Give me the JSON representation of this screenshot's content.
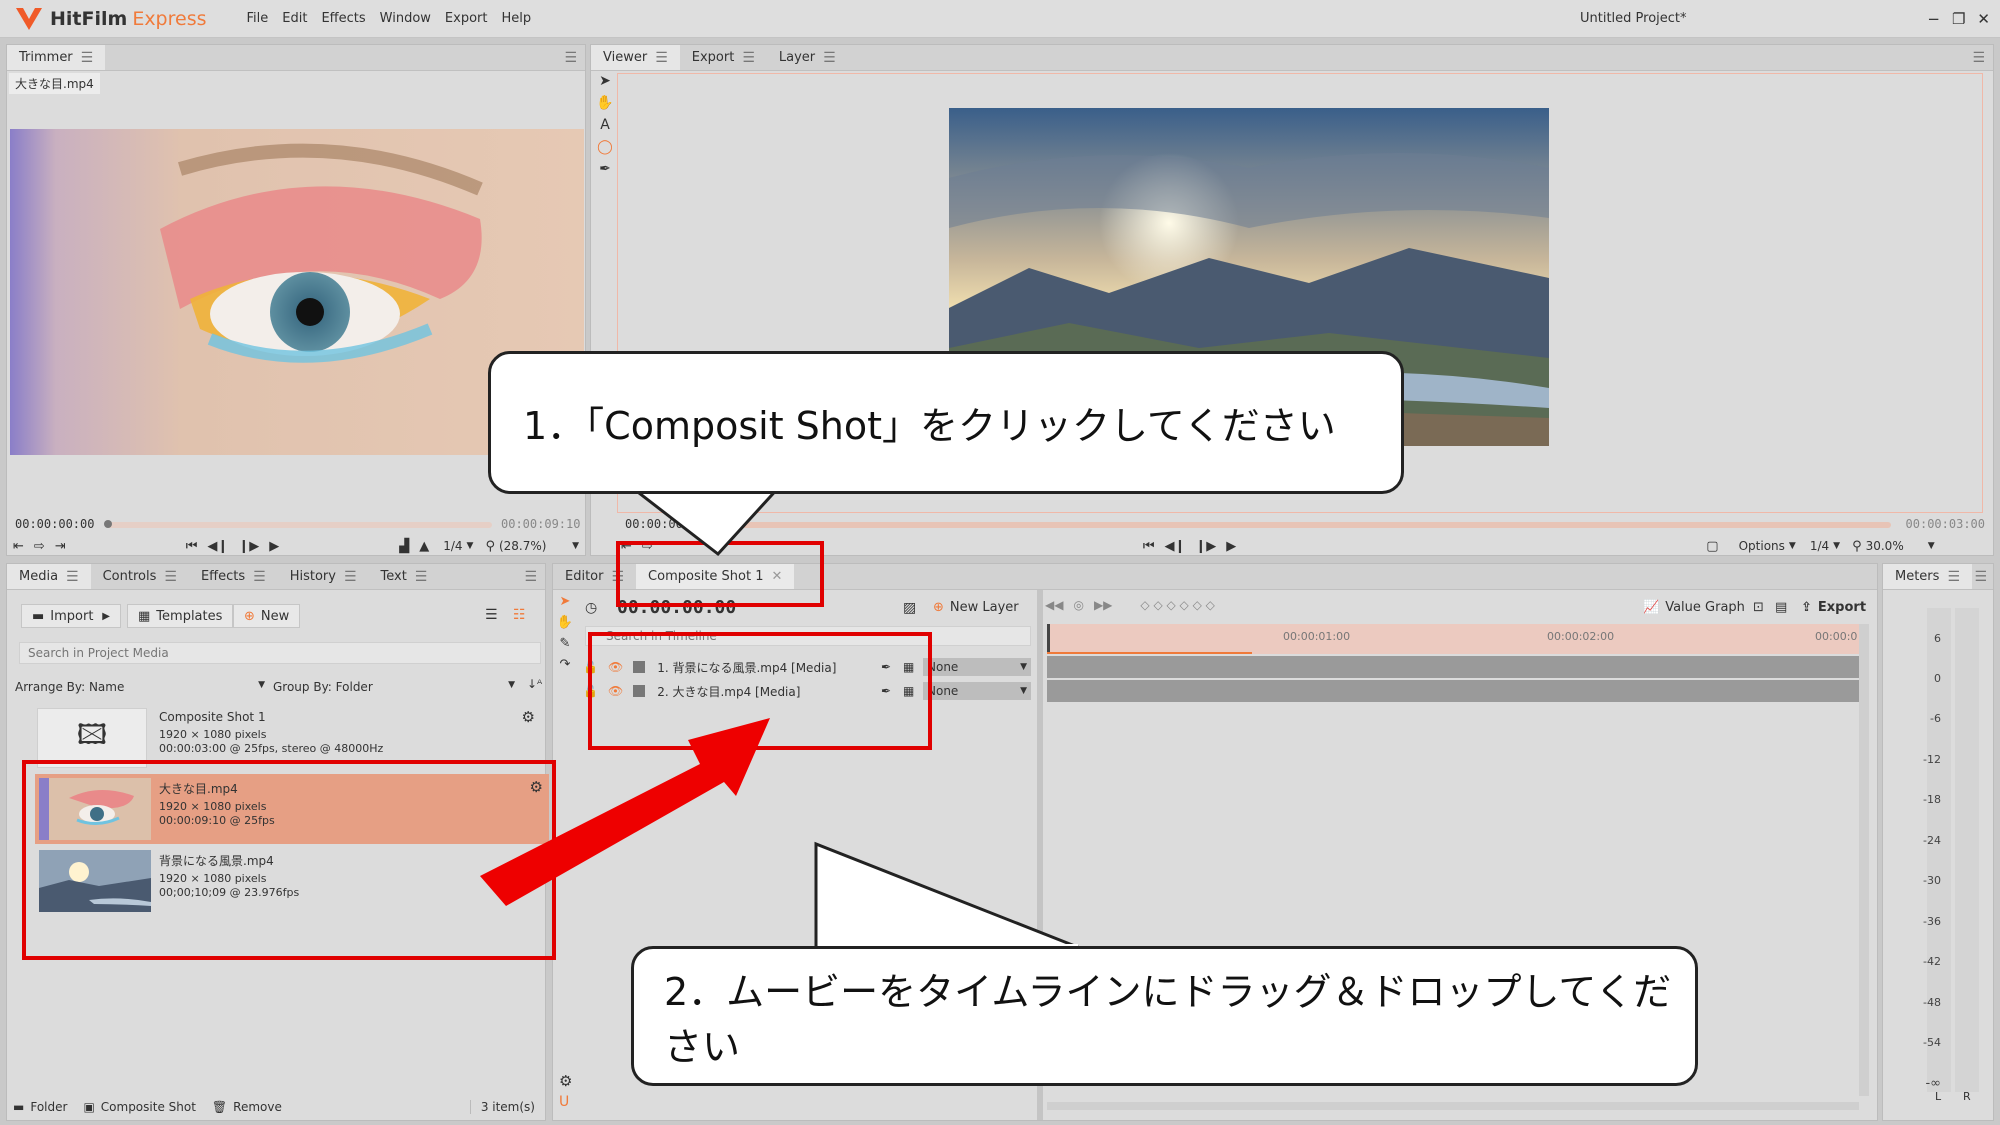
{
  "app": {
    "brand_a": "HitFilm",
    "brand_b": "Express",
    "project": "Untitled Project*",
    "menu": [
      "File",
      "Edit",
      "Effects",
      "Window",
      "Export",
      "Help"
    ]
  },
  "colors": {
    "accent": "#f07a3a",
    "brand_orange": "#f05a28",
    "highlight": "#e69f84",
    "red_box": "#e00000"
  },
  "trimmer": {
    "tab": "Trimmer",
    "file": "大きな目.mp4",
    "tc_start": "00:00:00:00",
    "tc_end": "00:00:09:10",
    "res": "1/4",
    "zoom": "(28.7%)"
  },
  "viewer": {
    "tabs": [
      "Viewer",
      "Export",
      "Layer"
    ],
    "tc_start": "00:00:00:00",
    "tc_end": "00:00:03:00",
    "options": "Options",
    "res": "1/4",
    "zoom": "30.0%"
  },
  "media": {
    "tabs": [
      "Media",
      "Controls",
      "Effects",
      "History",
      "Text"
    ],
    "import": "Import",
    "templates": "Templates",
    "new": "New",
    "search_placeholder": "Search in Project Media",
    "arrange": "Arrange By: Name",
    "group": "Group By: Folder",
    "items": [
      {
        "name": "Composite Shot 1",
        "line1": "1920 × 1080 pixels",
        "line2": "00:00:03:00 @ 25fps, stereo @ 48000Hz"
      },
      {
        "name": "大きな目.mp4",
        "line1": "1920 × 1080 pixels",
        "line2": "00:00:09:10 @ 25fps"
      },
      {
        "name": "背景になる風景.mp4",
        "line1": "1920 × 1080 pixels",
        "line2": "00;00;10;09 @ 23.976fps"
      }
    ],
    "footer": {
      "folder": "Folder",
      "composite": "Composite Shot",
      "remove": "Remove",
      "count": "3 item(s)"
    }
  },
  "editor": {
    "tab": "Editor",
    "comp_tab": "Composite Shot 1",
    "timecode": "00:00:00:00",
    "search_placeholder": "Search in Timeline",
    "new_layer": "New Layer",
    "value_graph": "Value Graph",
    "export": "Export",
    "ruler": [
      "00:00:01:00",
      "00:00:02:00",
      "00:00:0"
    ],
    "layers": [
      {
        "name": "1. 背景になる風景.mp4 [Media]",
        "blend": "None"
      },
      {
        "name": "2. 大きな目.mp4 [Media]",
        "blend": "None"
      }
    ]
  },
  "meters": {
    "tab": "Meters",
    "scale": [
      "6",
      "0",
      "-6",
      "-12",
      "-18",
      "-24",
      "-30",
      "-36",
      "-42",
      "-48",
      "-54",
      "-∞"
    ],
    "l": "L",
    "r": "R"
  },
  "callouts": {
    "one": "1．「Composit Shot」をクリックしてください",
    "two": "2．ムービーをタイムラインにドラッグ＆ドロップしてください"
  }
}
